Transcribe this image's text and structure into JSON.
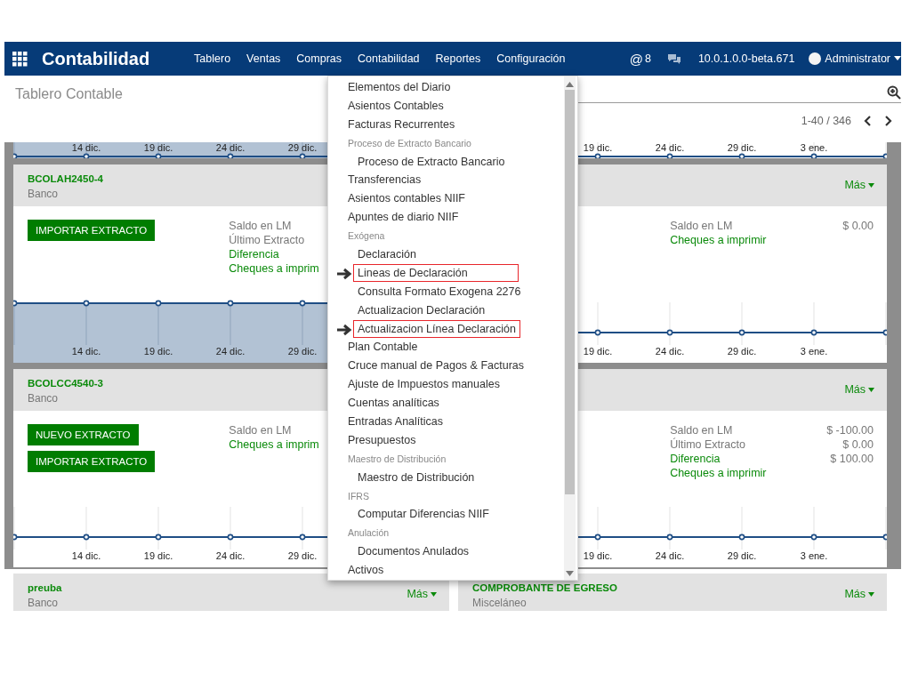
{
  "navbar": {
    "app_title": "Contabilidad",
    "menus": [
      {
        "label": "Tablero"
      },
      {
        "label": "Ventas"
      },
      {
        "label": "Compras"
      },
      {
        "label": "Contabilidad"
      },
      {
        "label": "Reportes"
      },
      {
        "label": "Configuración"
      }
    ],
    "mention_symbol": "@",
    "mentions": "8",
    "version": "10.0.1.0.0-beta.671",
    "user": "Administrator"
  },
  "control_panel": {
    "breadcrumb": "Tablero Contable",
    "pager": "1-40 / 346"
  },
  "kanban_rows": [
    [
      {
        "kind": "chart-strip",
        "chart": {
          "kind": "area",
          "x_labels": [
            "14 dic.",
            "19 dic.",
            "24 dic.",
            "29 dic."
          ]
        }
      },
      {
        "kind": "chart-strip",
        "chart": {
          "kind": "line",
          "x_labels": [
            "19 dic.",
            "24 dic.",
            "29 dic.",
            "3 ene."
          ]
        }
      }
    ],
    [
      {
        "kind": "journal",
        "title": "BCOLAH2450-4",
        "subtitle": "Banco",
        "buttons": [
          "IMPORTAR EXTRACTO"
        ],
        "stats": [
          {
            "label": "Saldo en LM",
            "kind": "plain"
          },
          {
            "label": "Último Extracto",
            "kind": "plain"
          },
          {
            "label": "Diferencia",
            "kind": "link"
          },
          {
            "label": "Cheques a imprim",
            "kind": "link"
          }
        ],
        "chart": {
          "kind": "area",
          "x_labels": [
            "14 dic.",
            "19 dic.",
            "24 dic.",
            "29 dic."
          ]
        }
      },
      {
        "kind": "journal",
        "more": "Más",
        "stats": [
          {
            "label": "Saldo en LM",
            "value": "$ 0.00",
            "kind": "plain"
          },
          {
            "label": "Cheques a imprimir",
            "kind": "link"
          }
        ],
        "chart": {
          "kind": "line",
          "x_labels": [
            "19 dic.",
            "24 dic.",
            "29 dic.",
            "3 ene."
          ]
        }
      }
    ],
    [
      {
        "kind": "journal",
        "title": "BCOLCC4540-3",
        "subtitle": "Banco",
        "buttons": [
          "NUEVO EXTRACTO",
          "IMPORTAR EXTRACTO"
        ],
        "stats": [
          {
            "label": "Saldo en LM",
            "kind": "plain"
          },
          {
            "label": "Cheques a imprim",
            "kind": "link"
          }
        ],
        "chart": {
          "kind": "line",
          "x_labels": [
            "14 dic.",
            "19 dic.",
            "24 dic.",
            "29 dic."
          ]
        }
      },
      {
        "kind": "journal",
        "more": "Más",
        "stats": [
          {
            "label": "Saldo en LM",
            "value": "$ -100.00",
            "kind": "plain"
          },
          {
            "label": "Último Extracto",
            "value": "$ 0.00",
            "kind": "plain"
          },
          {
            "label": "Diferencia",
            "value": "$ 100.00",
            "kind": "link"
          },
          {
            "label": "Cheques a imprimir",
            "kind": "link"
          }
        ],
        "chart": {
          "kind": "line",
          "x_labels": [
            "19 dic.",
            "24 dic.",
            "29 dic.",
            "3 ene."
          ]
        }
      }
    ],
    [
      {
        "kind": "journal",
        "title": "preuba",
        "subtitle": "Banco",
        "more": "Más"
      },
      {
        "kind": "journal",
        "title": "COMPROBANTE DE EGRESO",
        "subtitle": "Misceláneo",
        "more": "Más"
      }
    ]
  ],
  "dropdown_menu": [
    {
      "label": "Elementos del Diario",
      "kind": "item",
      "highlighted": false
    },
    {
      "label": "Asientos Contables",
      "kind": "item",
      "highlighted": false
    },
    {
      "label": "Facturas Recurrentes",
      "kind": "item",
      "highlighted": false
    },
    {
      "label": "Proceso de Extracto Bancario",
      "kind": "header",
      "highlighted": false
    },
    {
      "label": "Proceso de Extracto Bancario",
      "kind": "subitem",
      "highlighted": false
    },
    {
      "label": "Transferencias",
      "kind": "item",
      "highlighted": false
    },
    {
      "label": "Asientos contables NIIF",
      "kind": "item",
      "highlighted": false
    },
    {
      "label": "Apuntes de diario NIIF",
      "kind": "item",
      "highlighted": false
    },
    {
      "label": "Exógena",
      "kind": "header",
      "highlighted": false
    },
    {
      "label": "Declaración",
      "kind": "subitem",
      "highlighted": false
    },
    {
      "label": "Lineas de Declaración",
      "kind": "subitem",
      "highlighted": true
    },
    {
      "label": "Consulta Formato Exogena 2276",
      "kind": "subitem",
      "highlighted": false
    },
    {
      "label": "Actualizacion Declaración",
      "kind": "subitem",
      "highlighted": false
    },
    {
      "label": "Actualizacion Línea Declaración",
      "kind": "subitem",
      "highlighted": true
    },
    {
      "label": "Plan Contable",
      "kind": "item",
      "highlighted": false
    },
    {
      "label": "Cruce manual de Pagos & Facturas",
      "kind": "item",
      "highlighted": false
    },
    {
      "label": "Ajuste de Impuestos manuales",
      "kind": "item",
      "highlighted": false
    },
    {
      "label": "Cuentas analíticas",
      "kind": "item",
      "highlighted": false
    },
    {
      "label": "Entradas Analíticas",
      "kind": "item",
      "highlighted": false
    },
    {
      "label": "Presupuestos",
      "kind": "item",
      "highlighted": false
    },
    {
      "label": "Maestro de Distribución",
      "kind": "header",
      "highlighted": false
    },
    {
      "label": "Maestro de Distribución",
      "kind": "subitem",
      "highlighted": false
    },
    {
      "label": "IFRS",
      "kind": "header",
      "highlighted": false
    },
    {
      "label": "Computar Diferencias NIIF",
      "kind": "subitem",
      "highlighted": false
    },
    {
      "label": "Anulación",
      "kind": "header",
      "highlighted": false
    },
    {
      "label": "Documentos Anulados",
      "kind": "subitem",
      "highlighted": false
    },
    {
      "label": "Activos",
      "kind": "item",
      "highlighted": false
    }
  ]
}
